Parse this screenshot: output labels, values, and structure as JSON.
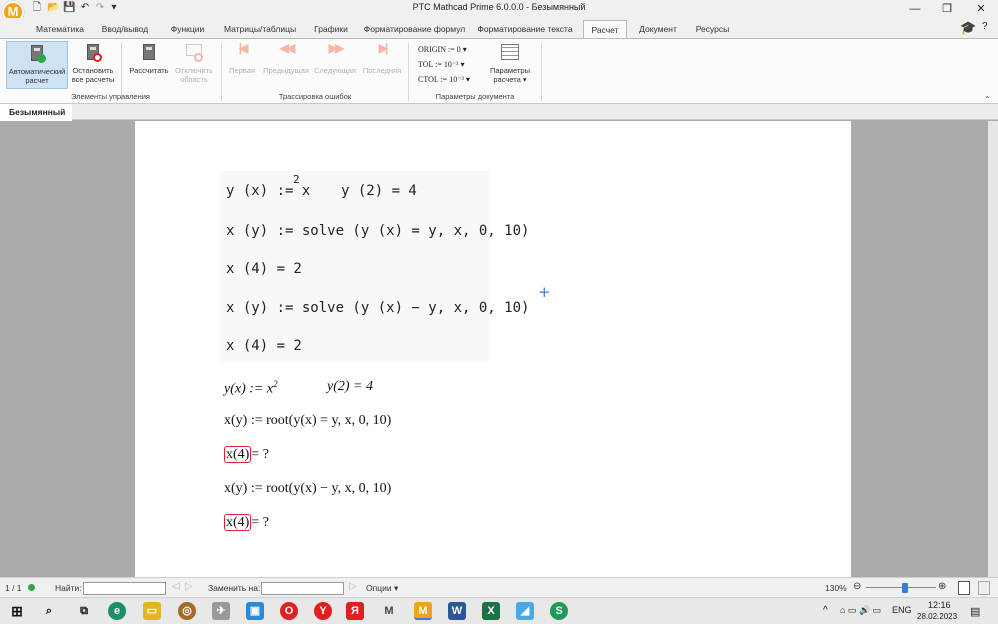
{
  "window": {
    "title": "PTC Mathcad Prime 6.0.0.0 - Безымянный",
    "app_logo": "M",
    "quick_access_icons": [
      "new-file-icon",
      "open-folder-icon",
      "save-icon",
      "undo-icon",
      "redo-icon",
      "quick-access-dropdown-icon"
    ],
    "controls": {
      "minimize": "—",
      "maximize": "❐",
      "close": "✕"
    }
  },
  "tabs": [
    "Математика",
    "Ввод/вывод",
    "Функции",
    "Матрицы/таблицы",
    "Графики",
    "Форматирование формул",
    "Форматирование текста",
    "Расчет",
    "Документ",
    "Ресурсы"
  ],
  "active_tab": "Расчет",
  "ribbon": {
    "controls_group": {
      "label": "Элементы управления",
      "auto_calc": {
        "line1": "Автоматический",
        "line2": "расчет"
      },
      "stop_calc": {
        "line1": "Остановить",
        "line2": "все расчеты"
      },
      "calculate": {
        "line1": "Рассчитать"
      },
      "disable_region": {
        "line1": "Отключить",
        "line2": "область"
      }
    },
    "trace_group": {
      "label": "Трассировка ошибок",
      "first": "Первая",
      "previous": "Предыдущая",
      "next": "Следующая",
      "last": "Последняя"
    },
    "doc_params_group": {
      "label": "Параметры документа",
      "origin": {
        "name": "ORIGIN",
        "op": ":=",
        "value": "0"
      },
      "tol": {
        "name": "TOL",
        "op": ":=",
        "value": "10⁻³"
      },
      "ctol": {
        "name": "CTOL",
        "op": ":=",
        "value": "10⁻³"
      },
      "calc_options": {
        "line1": "Параметры",
        "line2": "расчета"
      }
    }
  },
  "document_tab": "Безымянный",
  "worksheet": {
    "block1": [
      "y (x) := x",
      "2",
      "y (2) = 4",
      "x (y) := solve (y (x) = y, x, 0, 10)",
      "x (4) = 2",
      "x (y) := solve (y (x) − y, x, 0, 10)",
      "x (4) = 2"
    ],
    "block2": {
      "l1a": "y(x) := x",
      "l1sup": "2",
      "l1b": "y(2) = 4",
      "l2": "x(y) := root(y(x) = y, x, 0, 10)",
      "l3box": "x(4)",
      "l3rest": "= ?",
      "l4": "x(y) := root(y(x) − y, x, 0, 10)",
      "l5box": "x(4)",
      "l5rest": "= ?"
    }
  },
  "statusbar": {
    "page": "1 / 1",
    "find_label": "Найти:",
    "find_value": "",
    "replace_label": "Заменить на:",
    "replace_value": "",
    "options": "Опции",
    "zoom": "130%"
  },
  "taskbar": {
    "lang": "ENG",
    "time": "12:16",
    "date": "28.02.2023"
  },
  "colors": {
    "accent": "#f2a21b",
    "error": "#dd2233",
    "cursor": "#3a7bd5"
  }
}
